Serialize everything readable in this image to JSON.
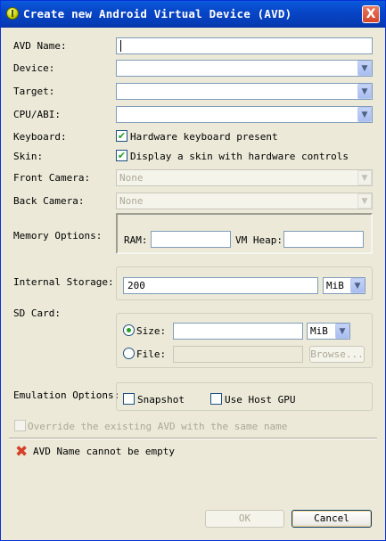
{
  "window": {
    "title": "Create new Android Virtual Device (AVD)",
    "close_glyph": "X"
  },
  "form": {
    "avd_name": {
      "label": "AVD Name:",
      "value": ""
    },
    "device": {
      "label": "Device:",
      "value": ""
    },
    "target": {
      "label": "Target:",
      "value": ""
    },
    "cpu_abi": {
      "label": "CPU/ABI:",
      "value": ""
    },
    "keyboard": {
      "label": "Keyboard:",
      "checkbox_label": "Hardware keyboard present",
      "checked": true
    },
    "skin": {
      "label": "Skin:",
      "checkbox_label": "Display a skin with hardware controls",
      "checked": true
    },
    "front_camera": {
      "label": "Front Camera:",
      "value": "None"
    },
    "back_camera": {
      "label": "Back Camera:",
      "value": "None"
    },
    "memory": {
      "label": "Memory Options:",
      "ram_label": "RAM:",
      "ram_value": "",
      "vm_heap_label": "VM Heap:",
      "vm_heap_value": ""
    },
    "internal_storage": {
      "label": "Internal Storage:",
      "value": "200",
      "unit": "MiB"
    },
    "sd_card": {
      "label": "SD Card:",
      "size_label": "Size:",
      "size_value": "",
      "size_unit": "MiB",
      "file_label": "File:",
      "file_value": "",
      "browse_label": "Browse...",
      "selected": "size"
    },
    "emulation": {
      "label": "Emulation Options:",
      "snapshot_label": "Snapshot",
      "snapshot_checked": false,
      "host_gpu_label": "Use Host GPU",
      "host_gpu_checked": false
    },
    "override": {
      "label": "Override the existing AVD with the same name",
      "checked": false
    }
  },
  "status": {
    "error_message": "AVD Name cannot be empty"
  },
  "buttons": {
    "ok_label": "OK",
    "cancel_label": "Cancel"
  },
  "icons": {
    "dropdown": "chevron-down-icon",
    "check": "check-icon",
    "error": "error-x-icon",
    "app": "android-sdk-icon"
  },
  "colors": {
    "titlebar": "#0846c8",
    "window_bg": "#ece9d8",
    "check_mark": "#21a121",
    "error_red": "#d6402a"
  }
}
